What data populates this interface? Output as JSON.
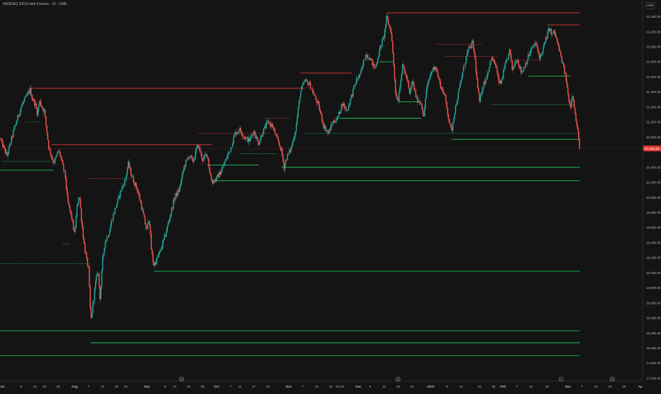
{
  "header": {
    "title": "NASDAQ 100 E-mini Futures · 1h · CME",
    "currency": "USD"
  },
  "colors": {
    "background": "#141414",
    "up": "#26a69a",
    "down": "#ef5350",
    "support": "#22c55e",
    "resistance": "#e53935",
    "axis_text": "#b2b5be",
    "last_price_bg": "#e53935"
  },
  "chart_data": {
    "type": "candlestick",
    "timeframe": "1h",
    "y_axis": {
      "labels": [
        "22,400.00",
        "22,200.00",
        "22,000.00",
        "21,800.00",
        "21,600.00",
        "21,400.00",
        "21,200.00",
        "21,000.00",
        "20,800.00",
        "20,400.00",
        "20,200.00",
        "20,000.00",
        "19,800.00",
        "19,600.00",
        "19,400.00",
        "19,200.00",
        "19,000.00",
        "18,800.00",
        "18,600.00",
        "18,400.00",
        "18,200.00",
        "18,000.00",
        "17,800.00",
        "17,600.00"
      ],
      "values": [
        22400,
        22200,
        22000,
        21800,
        21600,
        21400,
        21200,
        21000,
        20800,
        20400,
        20200,
        20000,
        19800,
        19600,
        19400,
        19200,
        19000,
        18800,
        18600,
        18400,
        18200,
        18000,
        17800,
        17600
      ],
      "ylim": [
        17560,
        22620
      ]
    },
    "x_axis": {
      "ticks": [
        {
          "label": "Jul",
          "d": 0,
          "bold": true
        },
        {
          "label": "9",
          "d": 8
        },
        {
          "label": "15",
          "d": 14
        },
        {
          "label": "19",
          "d": 18
        },
        {
          "label": "25",
          "d": 24
        },
        {
          "label": "Aug",
          "d": 31,
          "bold": true
        },
        {
          "label": "7",
          "d": 37
        },
        {
          "label": "13",
          "d": 43
        },
        {
          "label": "19",
          "d": 49
        },
        {
          "label": "23",
          "d": 53
        },
        {
          "label": "Sep",
          "d": 62,
          "bold": true
        },
        {
          "label": "9",
          "d": 70
        },
        {
          "label": "13",
          "d": 74
        },
        {
          "label": "19",
          "d": 80
        },
        {
          "label": "25",
          "d": 86
        },
        {
          "label": "Oct",
          "d": 92,
          "bold": true
        },
        {
          "label": "7",
          "d": 98
        },
        {
          "label": "11",
          "d": 102
        },
        {
          "label": "17",
          "d": 108
        },
        {
          "label": "23",
          "d": 114
        },
        {
          "label": "Nov",
          "d": 123,
          "bold": true
        },
        {
          "label": "7",
          "d": 129
        },
        {
          "label": "13",
          "d": 135
        },
        {
          "label": "19",
          "d": 141
        },
        {
          "label": "21:30",
          "d": 145
        },
        {
          "label": "Dec",
          "d": 153,
          "bold": true
        },
        {
          "label": "6",
          "d": 158
        },
        {
          "label": "12",
          "d": 164
        },
        {
          "label": "18",
          "d": 170
        },
        {
          "label": "24",
          "d": 176
        },
        {
          "label": "2025",
          "d": 184,
          "bold": true
        },
        {
          "label": "8",
          "d": 191
        },
        {
          "label": "14",
          "d": 197
        },
        {
          "label": "22",
          "d": 205
        },
        {
          "label": "28",
          "d": 211
        },
        {
          "label": "Feb",
          "d": 215,
          "bold": true
        },
        {
          "label": "7",
          "d": 221
        },
        {
          "label": "13",
          "d": 227
        },
        {
          "label": "20",
          "d": 234
        },
        {
          "label": "Mar",
          "d": 243,
          "bold": true
        },
        {
          "label": "7",
          "d": 249
        },
        {
          "label": "13",
          "d": 255
        },
        {
          "label": "19",
          "d": 261
        },
        {
          "label": "25",
          "d": 267
        },
        {
          "label": "Ap",
          "d": 274,
          "bold": true
        }
      ],
      "markers": [
        {
          "label": "14",
          "d": 77
        },
        {
          "label": "14",
          "d": 170
        },
        {
          "label": "F",
          "d": 240
        },
        {
          "label": "14",
          "d": 262
        }
      ],
      "xlim": [
        -1,
        275
      ]
    },
    "last_price": {
      "label": "20,650.25",
      "value": 20650
    },
    "path": [
      [
        -1,
        20780
      ],
      [
        2,
        20550
      ],
      [
        5,
        20900
      ],
      [
        8,
        21200
      ],
      [
        10,
        21320
      ],
      [
        12,
        21430
      ],
      [
        13,
        21300
      ],
      [
        14,
        21250
      ],
      [
        15,
        21120
      ],
      [
        16,
        21280
      ],
      [
        17,
        21200
      ],
      [
        18,
        21150
      ],
      [
        19,
        20900
      ],
      [
        20,
        20650
      ],
      [
        21,
        20560
      ],
      [
        22,
        20460
      ],
      [
        23,
        20520
      ],
      [
        24,
        20620
      ],
      [
        25,
        20550
      ],
      [
        26,
        20400
      ],
      [
        27,
        20300
      ],
      [
        28,
        19950
      ],
      [
        30,
        19700
      ],
      [
        31,
        19500
      ],
      [
        32,
        19850
      ],
      [
        33,
        20050
      ],
      [
        34,
        19700
      ],
      [
        35,
        19400
      ],
      [
        36,
        19200
      ],
      [
        37,
        19050
      ],
      [
        38,
        18350
      ],
      [
        39,
        18600
      ],
      [
        40,
        18850
      ],
      [
        41,
        19050
      ],
      [
        42,
        18650
      ],
      [
        43,
        19150
      ],
      [
        44,
        19400
      ],
      [
        46,
        19550
      ],
      [
        47,
        19700
      ],
      [
        49,
        19900
      ],
      [
        51,
        20100
      ],
      [
        53,
        20250
      ],
      [
        54,
        20450
      ],
      [
        55,
        20350
      ],
      [
        56,
        20250
      ],
      [
        58,
        20100
      ],
      [
        60,
        19850
      ],
      [
        62,
        19550
      ],
      [
        63,
        19750
      ],
      [
        64,
        19300
      ],
      [
        65,
        19100
      ],
      [
        66,
        19150
      ],
      [
        68,
        19300
      ],
      [
        70,
        19500
      ],
      [
        72,
        19750
      ],
      [
        74,
        20000
      ],
      [
        76,
        20100
      ],
      [
        78,
        20400
      ],
      [
        80,
        20550
      ],
      [
        82,
        20480
      ],
      [
        84,
        20700
      ],
      [
        86,
        20500
      ],
      [
        88,
        20580
      ],
      [
        89,
        20350
      ],
      [
        90,
        20200
      ],
      [
        92,
        20250
      ],
      [
        94,
        20350
      ],
      [
        96,
        20500
      ],
      [
        98,
        20650
      ],
      [
        100,
        20850
      ],
      [
        102,
        20900
      ],
      [
        104,
        20800
      ],
      [
        106,
        20750
      ],
      [
        108,
        20880
      ],
      [
        110,
        20720
      ],
      [
        112,
        20880
      ],
      [
        114,
        21000
      ],
      [
        116,
        20950
      ],
      [
        117,
        20850
      ],
      [
        119,
        20700
      ],
      [
        120,
        20600
      ],
      [
        121,
        20400
      ],
      [
        122,
        20520
      ],
      [
        124,
        20650
      ],
      [
        126,
        20900
      ],
      [
        128,
        21400
      ],
      [
        130,
        21550
      ],
      [
        132,
        21500
      ],
      [
        134,
        21350
      ],
      [
        136,
        21200
      ],
      [
        138,
        20950
      ],
      [
        140,
        20850
      ],
      [
        142,
        21000
      ],
      [
        144,
        21050
      ],
      [
        146,
        21250
      ],
      [
        148,
        21150
      ],
      [
        150,
        21350
      ],
      [
        152,
        21550
      ],
      [
        154,
        21650
      ],
      [
        156,
        21900
      ],
      [
        158,
        21850
      ],
      [
        160,
        21700
      ],
      [
        162,
        21950
      ],
      [
        164,
        22150
      ],
      [
        165,
        22380
      ],
      [
        167,
        22200
      ],
      [
        168,
        21800
      ],
      [
        169,
        21350
      ],
      [
        170,
        21300
      ],
      [
        171,
        21550
      ],
      [
        172,
        21750
      ],
      [
        174,
        21550
      ],
      [
        175,
        21350
      ],
      [
        176,
        21550
      ],
      [
        178,
        21300
      ],
      [
        180,
        21250
      ],
      [
        181,
        21050
      ],
      [
        182,
        21400
      ],
      [
        184,
        21650
      ],
      [
        186,
        21750
      ],
      [
        188,
        21500
      ],
      [
        190,
        21350
      ],
      [
        192,
        21000
      ],
      [
        193,
        20870
      ],
      [
        194,
        21100
      ],
      [
        196,
        21400
      ],
      [
        198,
        21700
      ],
      [
        200,
        21950
      ],
      [
        202,
        22050
      ],
      [
        203,
        21850
      ],
      [
        204,
        21500
      ],
      [
        205,
        21250
      ],
      [
        206,
        21450
      ],
      [
        208,
        21600
      ],
      [
        210,
        21850
      ],
      [
        212,
        21750
      ],
      [
        213,
        21550
      ],
      [
        214,
        21500
      ],
      [
        216,
        21750
      ],
      [
        218,
        21950
      ],
      [
        219,
        21700
      ],
      [
        221,
        21850
      ],
      [
        223,
        21650
      ],
      [
        225,
        21800
      ],
      [
        227,
        21950
      ],
      [
        229,
        22050
      ],
      [
        231,
        21850
      ],
      [
        233,
        22050
      ],
      [
        235,
        22250
      ],
      [
        236,
        22150
      ],
      [
        237,
        22200
      ],
      [
        238,
        22100
      ],
      [
        240,
        21850
      ],
      [
        242,
        21600
      ],
      [
        243,
        21350
      ],
      [
        244,
        21200
      ],
      [
        245,
        21400
      ],
      [
        246,
        21100
      ],
      [
        247,
        20900
      ],
      [
        248,
        20650
      ]
    ],
    "support_levels": [
      {
        "value": 21000,
        "from": 10,
        "to": 16,
        "style": "dotted"
      },
      {
        "value": 20480,
        "from": 0,
        "to": 21,
        "style": "dotted"
      },
      {
        "value": 20360,
        "from": -1,
        "to": 22,
        "style": "solid"
      },
      {
        "value": 19380,
        "from": 26,
        "to": 29,
        "style": "dotted"
      },
      {
        "value": 19120,
        "from": -1,
        "to": 38,
        "style": "dotted"
      },
      {
        "value": 20430,
        "from": 88,
        "to": 110,
        "style": "solid"
      },
      {
        "value": 20580,
        "from": 102,
        "to": 118,
        "style": "dotted"
      },
      {
        "value": 20400,
        "from": 120,
        "to": 248,
        "style": "solid"
      },
      {
        "value": 20220,
        "from": 90,
        "to": 248,
        "style": "solid"
      },
      {
        "value": 19020,
        "from": 65,
        "to": 248,
        "style": "solid"
      },
      {
        "value": 18230,
        "from": -1,
        "to": 248,
        "style": "solid"
      },
      {
        "value": 18070,
        "from": 38,
        "to": 248,
        "style": "solid"
      },
      {
        "value": 17900,
        "from": -1,
        "to": 248,
        "style": "solid"
      },
      {
        "value": 21050,
        "from": 145,
        "to": 180,
        "style": "solid"
      },
      {
        "value": 21800,
        "from": 162,
        "to": 168,
        "style": "solid"
      },
      {
        "value": 21270,
        "from": 170,
        "to": 180,
        "style": "solid"
      },
      {
        "value": 20850,
        "from": 130,
        "to": 248,
        "style": "dotted"
      },
      {
        "value": 20770,
        "from": 193,
        "to": 248,
        "style": "solid"
      },
      {
        "value": 21230,
        "from": 210,
        "to": 246,
        "style": "dotted"
      },
      {
        "value": 21610,
        "from": 226,
        "to": 244,
        "style": "solid"
      }
    ],
    "resistance_levels": [
      {
        "value": 21450,
        "from": 12,
        "to": 130,
        "style": "solid"
      },
      {
        "value": 20700,
        "from": 21,
        "to": 90,
        "style": "solid"
      },
      {
        "value": 20250,
        "from": 37,
        "to": 56,
        "style": "dotted"
      },
      {
        "value": 20850,
        "from": 84,
        "to": 115,
        "style": "dotted"
      },
      {
        "value": 21050,
        "from": 113,
        "to": 124,
        "style": "dotted"
      },
      {
        "value": 21650,
        "from": 128,
        "to": 150,
        "style": "solid"
      },
      {
        "value": 22450,
        "from": 165,
        "to": 248,
        "style": "solid"
      },
      {
        "value": 22290,
        "from": 234,
        "to": 248,
        "style": "solid"
      },
      {
        "value": 22030,
        "from": 186,
        "to": 206,
        "style": "dotted"
      },
      {
        "value": 21870,
        "from": 190,
        "to": 213,
        "style": "dotted"
      },
      {
        "value": 21820,
        "from": 218,
        "to": 232,
        "style": "dotted"
      }
    ]
  }
}
